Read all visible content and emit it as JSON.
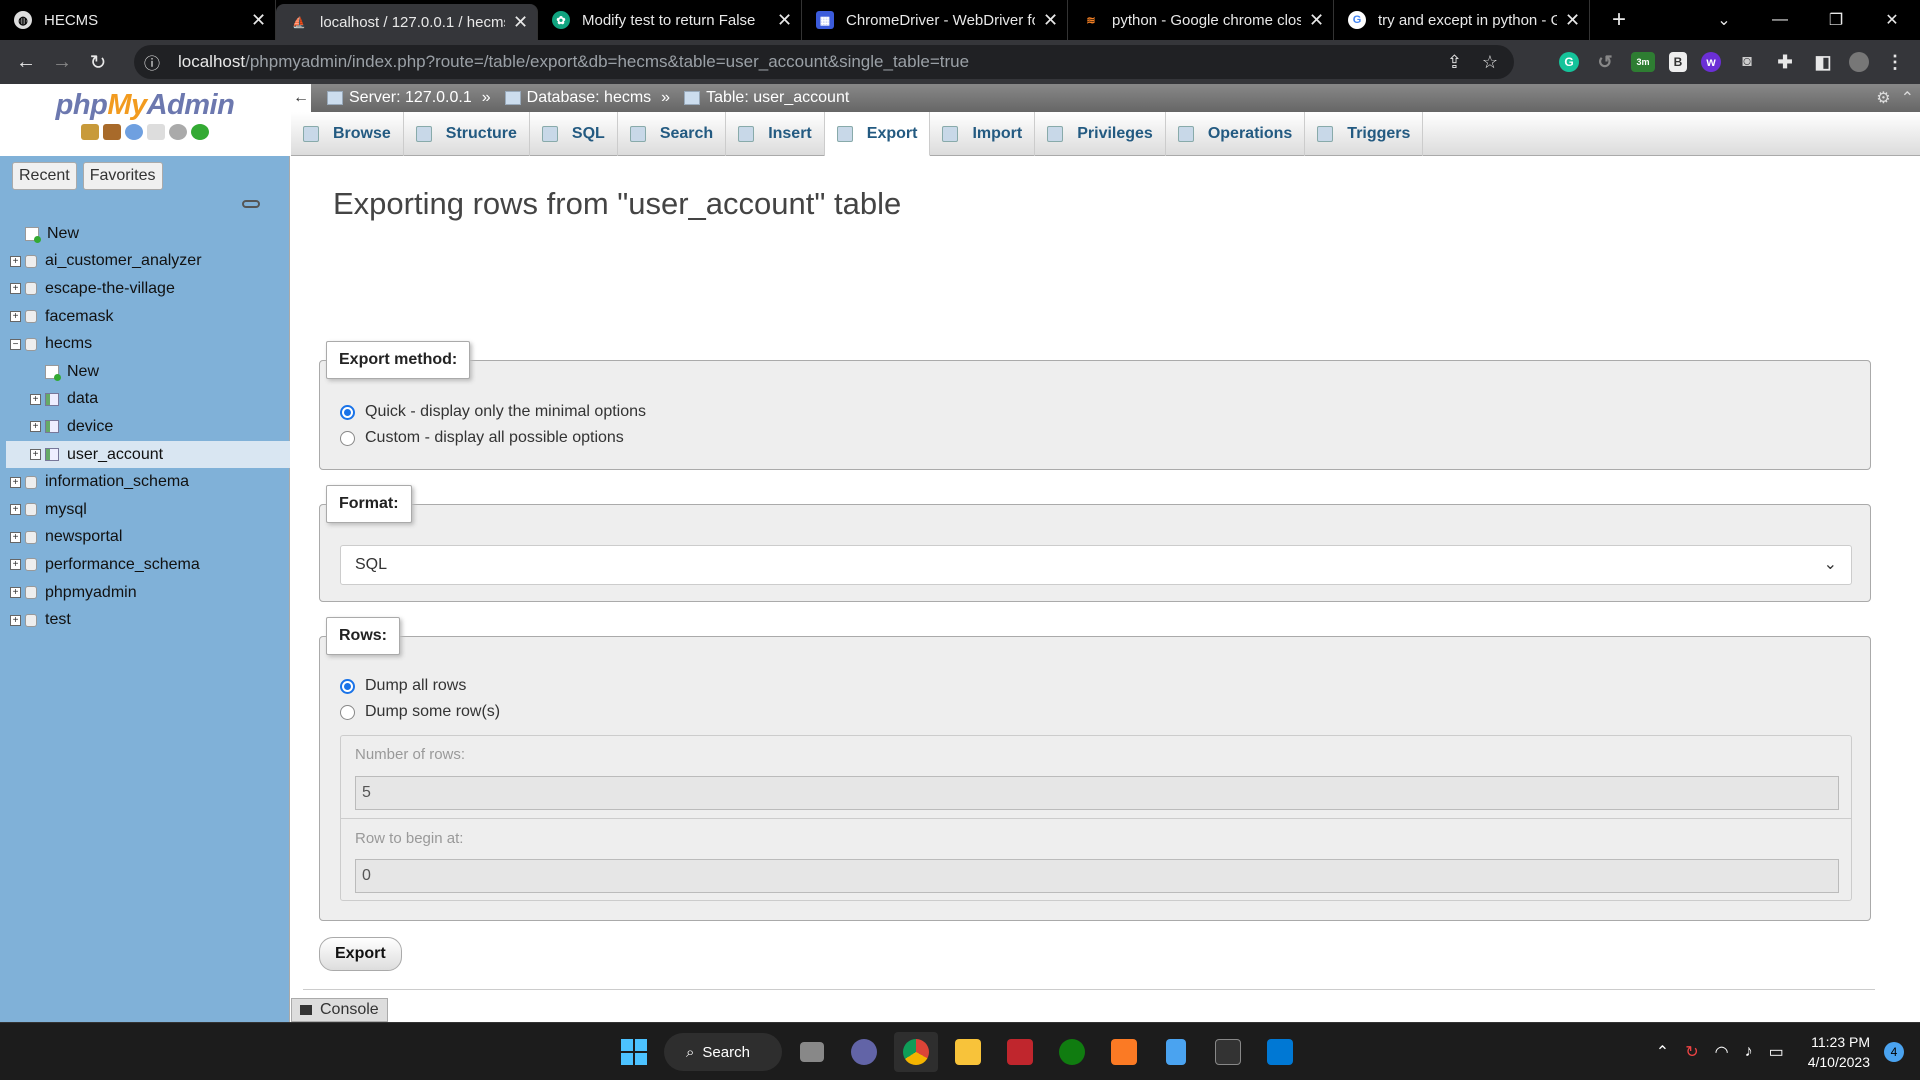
{
  "browser": {
    "tabs": [
      {
        "title": "HECMS",
        "icon": "globe-icon",
        "active": false
      },
      {
        "title": "localhost / 127.0.0.1 / hecms /",
        "icon": "phpmyadmin-icon",
        "active": true
      },
      {
        "title": "Modify test to return False",
        "icon": "chatgpt-icon",
        "active": false
      },
      {
        "title": "ChromeDriver - WebDriver fo",
        "icon": "chromedriver-icon",
        "active": false
      },
      {
        "title": "python - Google chrome clos",
        "icon": "stackoverflow-icon",
        "active": false
      },
      {
        "title": "try and except in python - Go",
        "icon": "google-icon",
        "active": false
      }
    ],
    "url_host": "localhost",
    "url_path": "/phpmyadmin/index.php?route=/table/export&db=hecms&table=user_account&single_table=true",
    "ext_badge": "3m"
  },
  "nav": {
    "logo_php": "php",
    "logo_my": "My",
    "logo_admin": "Admin",
    "recent": "Recent",
    "favorites": "Favorites",
    "tree": [
      {
        "label": "New",
        "type": "new",
        "level": 0,
        "expander": ""
      },
      {
        "label": "ai_customer_analyzer",
        "type": "db",
        "level": 0,
        "expander": "+"
      },
      {
        "label": "escape-the-village",
        "type": "db",
        "level": 0,
        "expander": "+"
      },
      {
        "label": "facemask",
        "type": "db",
        "level": 0,
        "expander": "+"
      },
      {
        "label": "hecms",
        "type": "db",
        "level": 0,
        "expander": "−"
      },
      {
        "label": "New",
        "type": "new",
        "level": 1,
        "expander": ""
      },
      {
        "label": "data",
        "type": "table",
        "level": 1,
        "expander": "+"
      },
      {
        "label": "device",
        "type": "table",
        "level": 1,
        "expander": "+"
      },
      {
        "label": "user_account",
        "type": "table",
        "level": 1,
        "expander": "+",
        "selected": true
      },
      {
        "label": "information_schema",
        "type": "db",
        "level": 0,
        "expander": "+"
      },
      {
        "label": "mysql",
        "type": "db",
        "level": 0,
        "expander": "+"
      },
      {
        "label": "newsportal",
        "type": "db",
        "level": 0,
        "expander": "+"
      },
      {
        "label": "performance_schema",
        "type": "db",
        "level": 0,
        "expander": "+"
      },
      {
        "label": "phpmyadmin",
        "type": "db",
        "level": 0,
        "expander": "+"
      },
      {
        "label": "test",
        "type": "db",
        "level": 0,
        "expander": "+"
      }
    ]
  },
  "breadcrumb": {
    "server": "Server: 127.0.0.1",
    "database": "Database: hecms",
    "table": "Table: user_account",
    "sep": "»"
  },
  "tabs": [
    {
      "label": "Browse",
      "active": false
    },
    {
      "label": "Structure",
      "active": false
    },
    {
      "label": "SQL",
      "active": false
    },
    {
      "label": "Search",
      "active": false
    },
    {
      "label": "Insert",
      "active": false
    },
    {
      "label": "Export",
      "active": true
    },
    {
      "label": "Import",
      "active": false
    },
    {
      "label": "Privileges",
      "active": false
    },
    {
      "label": "Operations",
      "active": false
    },
    {
      "label": "Triggers",
      "active": false
    }
  ],
  "page": {
    "title": "Exporting rows from \"user_account\" table",
    "export_method": {
      "legend": "Export method:",
      "quick": "Quick - display only the minimal options",
      "custom": "Custom - display all possible options",
      "selected": "quick"
    },
    "format": {
      "legend": "Format:",
      "value": "SQL"
    },
    "rows": {
      "legend": "Rows:",
      "dump_all": "Dump all rows",
      "dump_some": "Dump some row(s)",
      "selected": "dump_all",
      "num_rows_label": "Number of rows:",
      "num_rows_value": "5",
      "begin_label": "Row to begin at:",
      "begin_value": "0"
    },
    "export_button": "Export"
  },
  "console": "Console",
  "taskbar": {
    "search": "Search",
    "time": "11:23 PM",
    "date": "4/10/2023",
    "notifications": "4"
  }
}
